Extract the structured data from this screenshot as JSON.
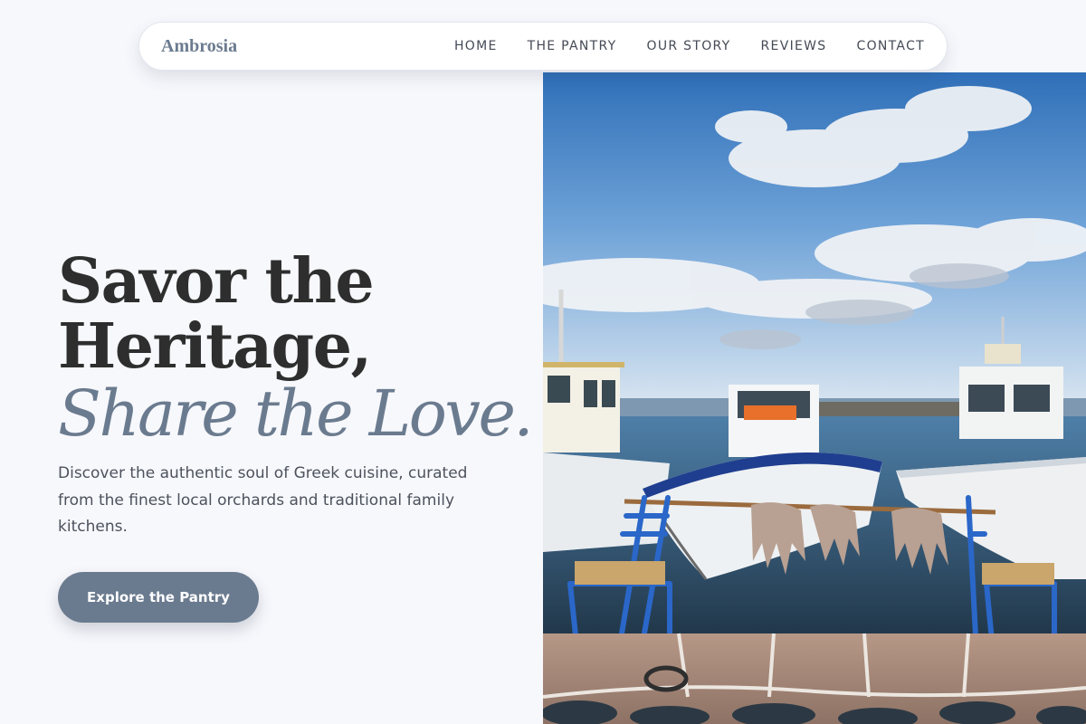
{
  "nav": {
    "brand": "Ambrosia",
    "links": [
      "HOME",
      "THE PANTRY",
      "OUR STORY",
      "REVIEWS",
      "CONTACT"
    ]
  },
  "hero": {
    "title_line1": "Savor the",
    "title_line2": "Heritage,",
    "title_italic": "Share the Love.",
    "subtitle": "Discover the authentic soul of Greek cuisine, curated from the finest local orchards and traditional family kitchens.",
    "cta_label": "Explore the Pantry"
  },
  "colors": {
    "accent": "#6b7b8f",
    "heading": "#2e2e2e",
    "background": "#f7f8fc",
    "chair_blue": "#2a67c9"
  },
  "image": {
    "subject": "greek-harbor-fishing-boats-octopus-blue-chairs"
  }
}
